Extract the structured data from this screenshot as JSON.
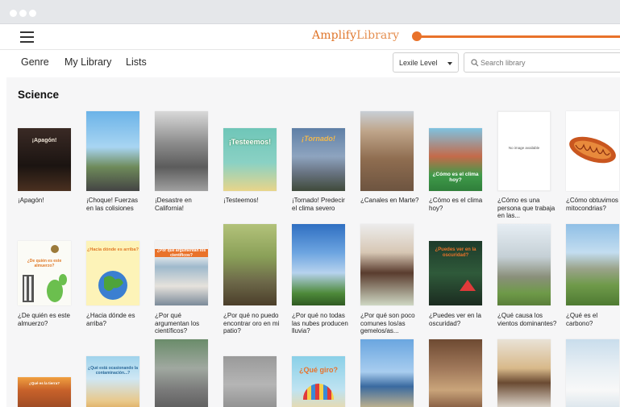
{
  "app": {
    "brand_part1": "Amplify",
    "brand_part2": "Library"
  },
  "nav": {
    "genre": "Genre",
    "my_library": "My Library",
    "lists": "Lists",
    "lexile_label": "Lexile Level",
    "search_placeholder": "Search library"
  },
  "section": {
    "title": "Science"
  },
  "books": [
    {
      "title": "¡Apagón!",
      "cover_text": "¡Apagón!"
    },
    {
      "title": "¡Choque! Fuerzas en las colisiones",
      "cover_text": ""
    },
    {
      "title": "¡Desastre en California!",
      "cover_text": ""
    },
    {
      "title": "¡Testeemos!",
      "cover_text": "¡Testeemos!"
    },
    {
      "title": "¡Tornado! Predecir el clima severo",
      "cover_text": "¡Tornado!"
    },
    {
      "title": "¿Canales en Marte?",
      "cover_text": ""
    },
    {
      "title": "¿Cómo es el clima hoy?",
      "cover_text": "¿Cómo es el clima hoy?"
    },
    {
      "title": "¿Cómo es una persona que trabaja en las...",
      "cover_text": "No image available"
    },
    {
      "title": "¿Cómo obtuvimos mitocondrias?",
      "cover_text": ""
    },
    {
      "title": "¿De quién es este almuerzo?",
      "cover_text": "¿De quién es este almuerzo?"
    },
    {
      "title": "¿Hacia dónde es arriba?",
      "cover_text": "¿Hacia dónde es arriba?"
    },
    {
      "title": "¿Por qué argumentan los científicos?",
      "cover_text": "¿Por qué argumentan los científicos?"
    },
    {
      "title": "¿Por qué no puedo encontrar oro en mi patio?",
      "cover_text": ""
    },
    {
      "title": "¿Por qué no todas las nubes producen lluvia?",
      "cover_text": ""
    },
    {
      "title": "¿Por qué son poco comunes los/as gemelos/as...",
      "cover_text": ""
    },
    {
      "title": "¿Puedes ver en la oscuridad?",
      "cover_text": "¿Puedes ver en la oscuridad?"
    },
    {
      "title": "¿Qué causa los vientos dominantes?",
      "cover_text": ""
    },
    {
      "title": "¿Qué es el carbono?",
      "cover_text": ""
    },
    {
      "title": "",
      "cover_text": "¿Qué es la tierra?"
    },
    {
      "title": "",
      "cover_text": "¿Qué está ocasionando la contaminación...?"
    },
    {
      "title": "",
      "cover_text": ""
    },
    {
      "title": "",
      "cover_text": ""
    },
    {
      "title": "",
      "cover_text": "¿Qué giro?"
    },
    {
      "title": "",
      "cover_text": ""
    },
    {
      "title": "",
      "cover_text": ""
    },
    {
      "title": "",
      "cover_text": ""
    },
    {
      "title": "",
      "cover_text": ""
    }
  ]
}
